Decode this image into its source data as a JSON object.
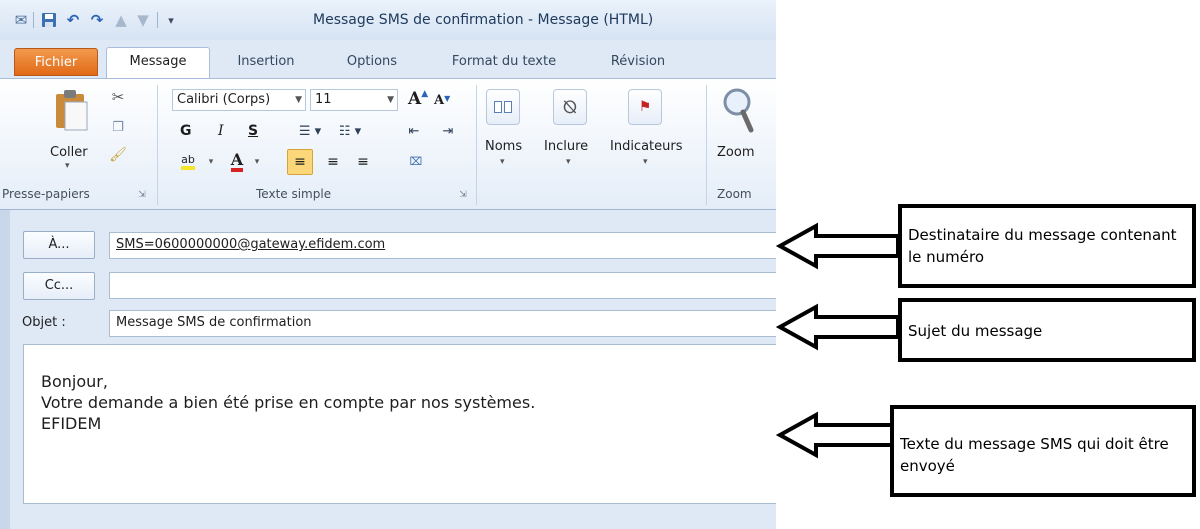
{
  "window": {
    "title": "Message SMS de confirmation  -  Message (HTML)"
  },
  "tabs": [
    {
      "label": "Fichier"
    },
    {
      "label": "Message"
    },
    {
      "label": "Insertion"
    },
    {
      "label": "Options"
    },
    {
      "label": "Format du texte"
    },
    {
      "label": "Révision"
    }
  ],
  "ribbon": {
    "clipboard": {
      "paste_label": "Coller",
      "group_label": "Presse-papiers"
    },
    "basic_text": {
      "font_name": "Calibri (Corps)",
      "font_size": "11",
      "bold": "G",
      "italic": "I",
      "underline": "S",
      "group_label": "Texte simple"
    },
    "names_label": "Noms",
    "include_label": "Inclure",
    "flags_label": "Indicateurs",
    "zoom_label": "Zoom",
    "zoom_group_label": "Zoom"
  },
  "form": {
    "to_button": "À...",
    "to_value": "SMS=0600000000@gateway.efidem.com",
    "cc_button": "Cc...",
    "cc_value": "",
    "subject_label": "Objet :",
    "subject_value": "Message SMS de confirmation",
    "body_lines": [
      "Bonjour,",
      "Votre demande a bien été prise en compte par nos systèmes.",
      "EFIDEM"
    ]
  },
  "annotations": [
    {
      "text": "Destinataire du message contenant le numéro"
    },
    {
      "text": "Sujet du message"
    },
    {
      "text": "Texte du message SMS qui doit être envoyé"
    }
  ]
}
